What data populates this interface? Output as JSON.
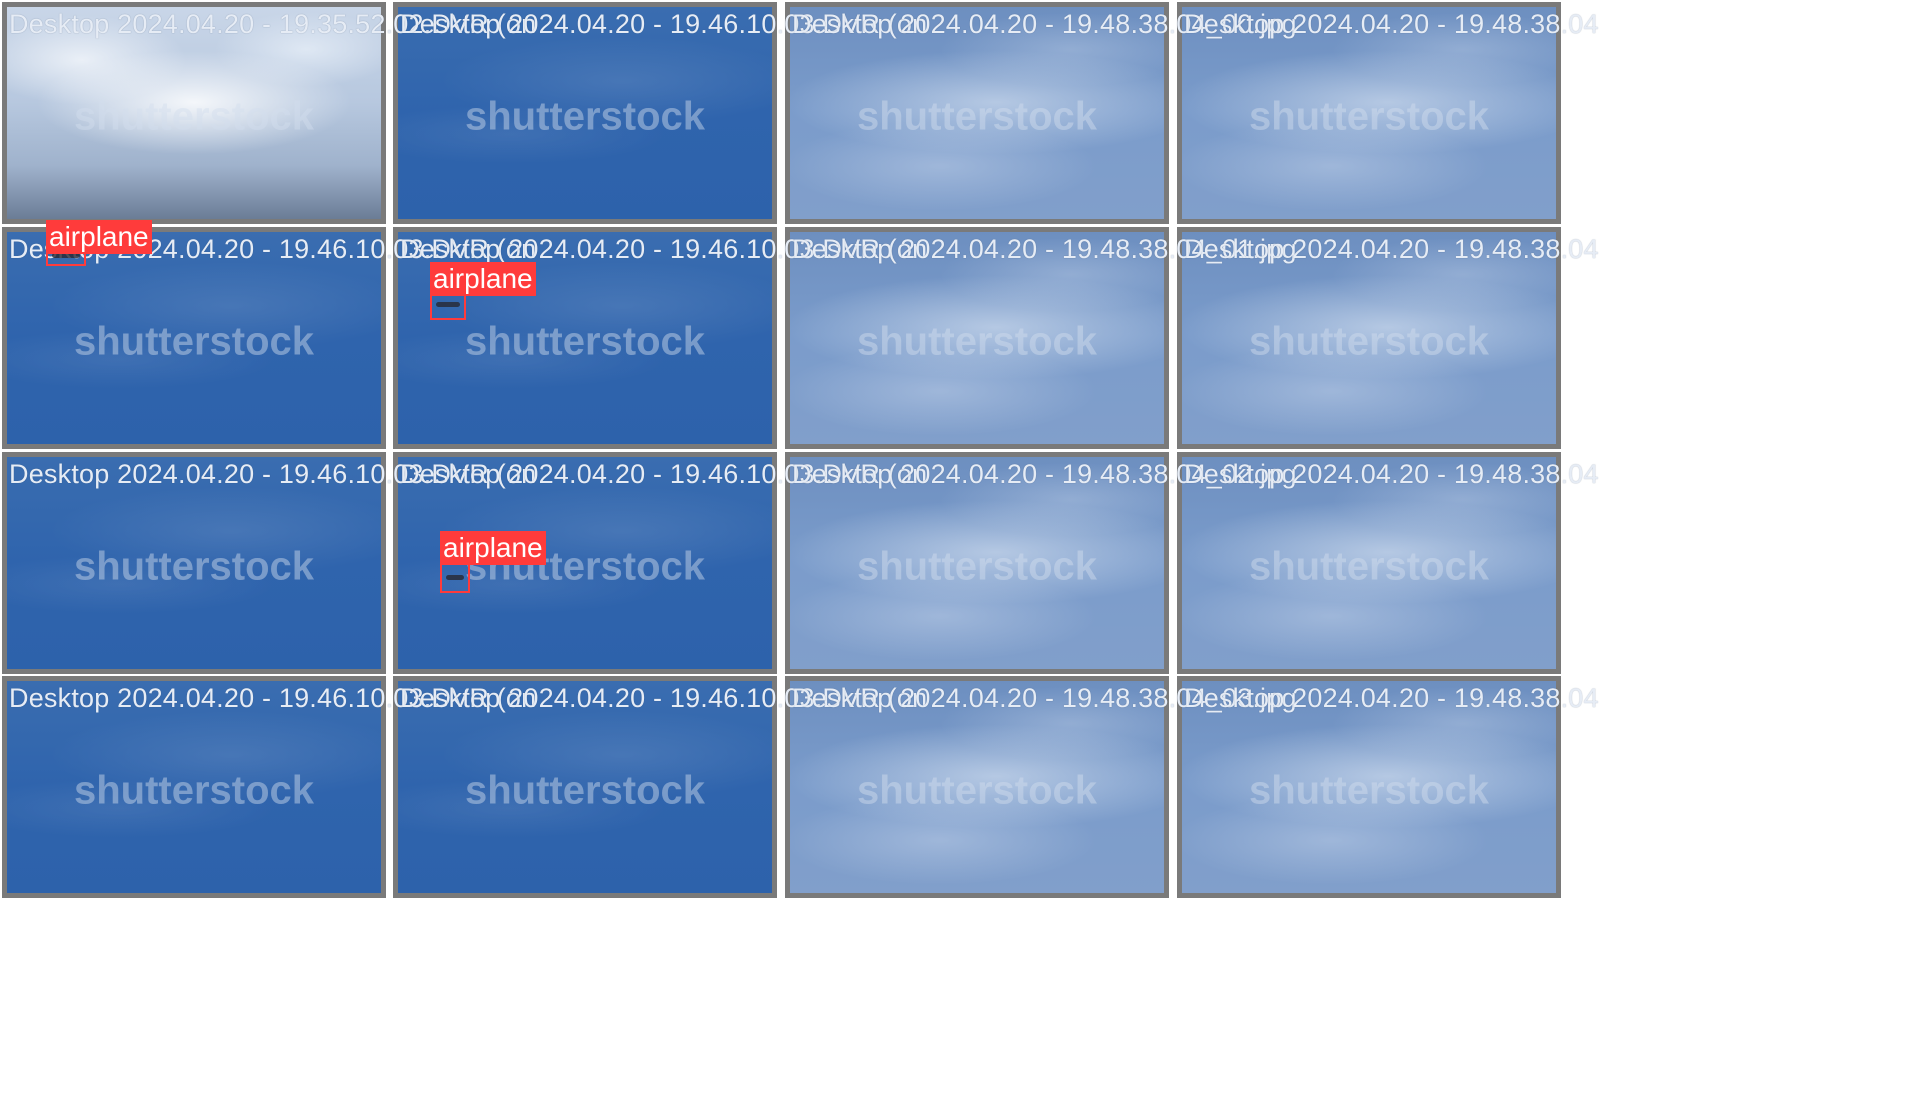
{
  "tiles": [
    {
      "title": "Desktop 2024.04.20 - 19.35.52.02.DVR (on",
      "watermark": "shutterstock",
      "sky": "cloudy"
    },
    {
      "title": "Desktop 2024.04.20 - 19.46.10.03.DVR (on",
      "watermark": "shutterstock",
      "sky": "blue"
    },
    {
      "title": "Desktop 2024.04.20 - 19.48.38.04_00.jpg",
      "watermark": "shutterstock",
      "sky": "hazy"
    },
    {
      "title": "Desktop 2024.04.20 - 19.48.38.04",
      "watermark": "shutterstock",
      "sky": "hazy"
    },
    {
      "title": "Desktop 2024.04.20 - 19.46.10.03.DVR (on",
      "watermark": "shutterstock",
      "sky": "blue"
    },
    {
      "title": "Desktop 2024.04.20 - 19.46.10.03.DVR (on",
      "watermark": "shutterstock",
      "sky": "blue"
    },
    {
      "title": "Desktop 2024.04.20 - 19.48.38.04_01.jpg",
      "watermark": "shutterstock",
      "sky": "hazy"
    },
    {
      "title": "Desktop 2024.04.20 - 19.48.38.04",
      "watermark": "shutterstock",
      "sky": "hazy"
    },
    {
      "title": "Desktop 2024.04.20 - 19.46.10.03.DVR (on",
      "watermark": "shutterstock",
      "sky": "blue"
    },
    {
      "title": "Desktop 2024.04.20 - 19.46.10.03.DVR (on",
      "watermark": "shutterstock",
      "sky": "blue"
    },
    {
      "title": "Desktop 2024.04.20 - 19.48.38.04_02.jpg",
      "watermark": "shutterstock",
      "sky": "hazy"
    },
    {
      "title": "Desktop 2024.04.20 - 19.48.38.04",
      "watermark": "shutterstock",
      "sky": "hazy"
    },
    {
      "title": "Desktop 2024.04.20 - 19.46.10.03.DVR (on",
      "watermark": "shutterstock",
      "sky": "blue"
    },
    {
      "title": "Desktop 2024.04.20 - 19.46.10.03.DVR (on",
      "watermark": "shutterstock",
      "sky": "blue"
    },
    {
      "title": "Desktop 2024.04.20 - 19.48.38.04_03.jpg",
      "watermark": "shutterstock",
      "sky": "hazy"
    },
    {
      "title": "Desktop 2024.04.20 - 19.48.38.04",
      "watermark": "shutterstock",
      "sky": "hazy"
    }
  ],
  "detections": [
    {
      "tile": 0,
      "label": "airplane"
    },
    {
      "tile": 4,
      "label": "airplane"
    },
    {
      "tile": 8,
      "label": "airplane"
    }
  ],
  "colors": {
    "detection": "#ff3b3b",
    "tile_border": "#7a7a7a",
    "overlay_green": "#7dbb00",
    "overlay_black": "#000000"
  }
}
